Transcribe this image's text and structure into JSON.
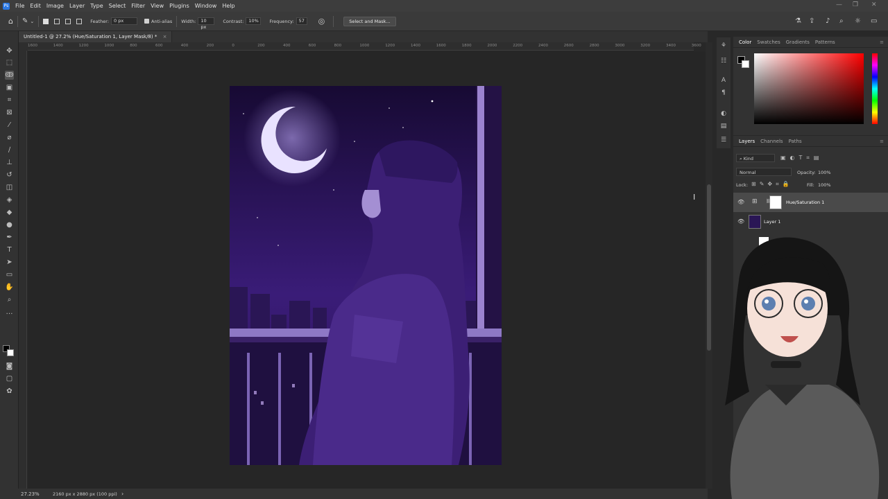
{
  "menubar": {
    "items": [
      "File",
      "Edit",
      "Image",
      "Layer",
      "Type",
      "Select",
      "Filter",
      "View",
      "Plugins",
      "Window",
      "Help"
    ]
  },
  "options": {
    "feather_label": "Feather:",
    "feather_value": "0 px",
    "antialias_label": "Anti-alias",
    "width_label": "Width:",
    "width_value": "10 px",
    "contrast_label": "Contrast:",
    "contrast_value": "10%",
    "frequency_label": "Frequency:",
    "frequency_value": "57",
    "select_mask_label": "Select and Mask..."
  },
  "document": {
    "tab_title": "Untitled-1 @ 27.2% (Hue/Saturation 1, Layer Mask/8) *",
    "tab_close": "×"
  },
  "ruler": {
    "h_ticks": [
      "1600",
      "1400",
      "1200",
      "1000",
      "800",
      "600",
      "400",
      "200",
      "0",
      "200",
      "400",
      "600",
      "800",
      "1000",
      "1200",
      "1400",
      "1600",
      "1800",
      "2000",
      "2200",
      "2400",
      "2600",
      "2800",
      "3000",
      "3200",
      "3400",
      "3600"
    ]
  },
  "status": {
    "zoom": "27.23%",
    "doc_size": "2160 px x 2880 px (100 ppi)",
    "arrow": "›"
  },
  "color_panel": {
    "tabs": [
      "Color",
      "Swatches",
      "Gradients",
      "Patterns"
    ],
    "active_tab": "Color",
    "hue_color": "#ff0000"
  },
  "layers_panel": {
    "tabs": [
      "Layers",
      "Channels",
      "Paths"
    ],
    "active_tab": "Layers",
    "filter_label": "Kind",
    "blend_mode": "Normal",
    "opacity_label": "Opacity:",
    "opacity_value": "100%",
    "lock_label": "Lock:",
    "fill_label": "Fill:",
    "fill_value": "100%",
    "layers": [
      {
        "name": "Hue/Saturation 1",
        "selected": true
      },
      {
        "name": "Layer 1",
        "selected": false
      }
    ]
  },
  "colors": {
    "accent": "#2b78e4",
    "artwork_purple": "#3a1d6e"
  }
}
